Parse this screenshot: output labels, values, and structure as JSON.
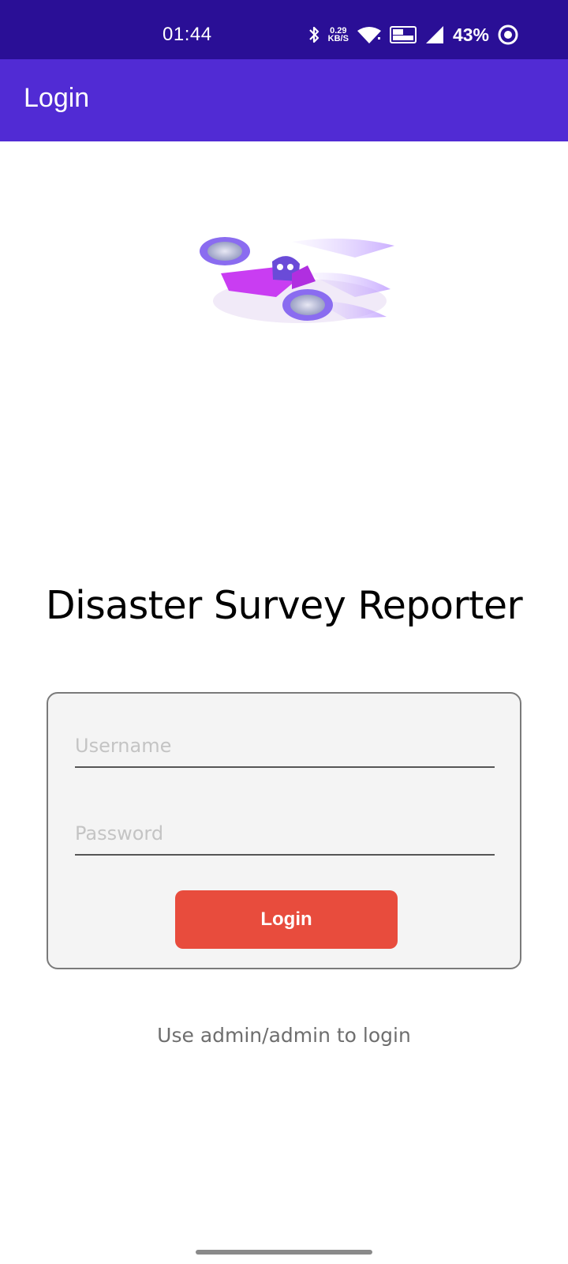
{
  "status_bar": {
    "time": "01:44",
    "net_speed_value": "0.29",
    "net_speed_unit": "KB/S",
    "battery": "43%",
    "icons": [
      "bluetooth-icon",
      "wifi-icon",
      "volte-lte-icon",
      "signal-icon",
      "battery-ring-icon"
    ]
  },
  "app_bar": {
    "title": "Login"
  },
  "hero": {
    "icon": "drone-mascot-illustration"
  },
  "heading": "Disaster Survey Reporter",
  "form": {
    "username_placeholder": "Username",
    "password_placeholder": "Password",
    "login_label": "Login"
  },
  "hint": "Use admin/admin to login",
  "colors": {
    "status_bar": "#2a0f96",
    "app_bar": "#512bd4",
    "login_button": "#e84c3d",
    "card_bg": "#f4f4f4"
  }
}
